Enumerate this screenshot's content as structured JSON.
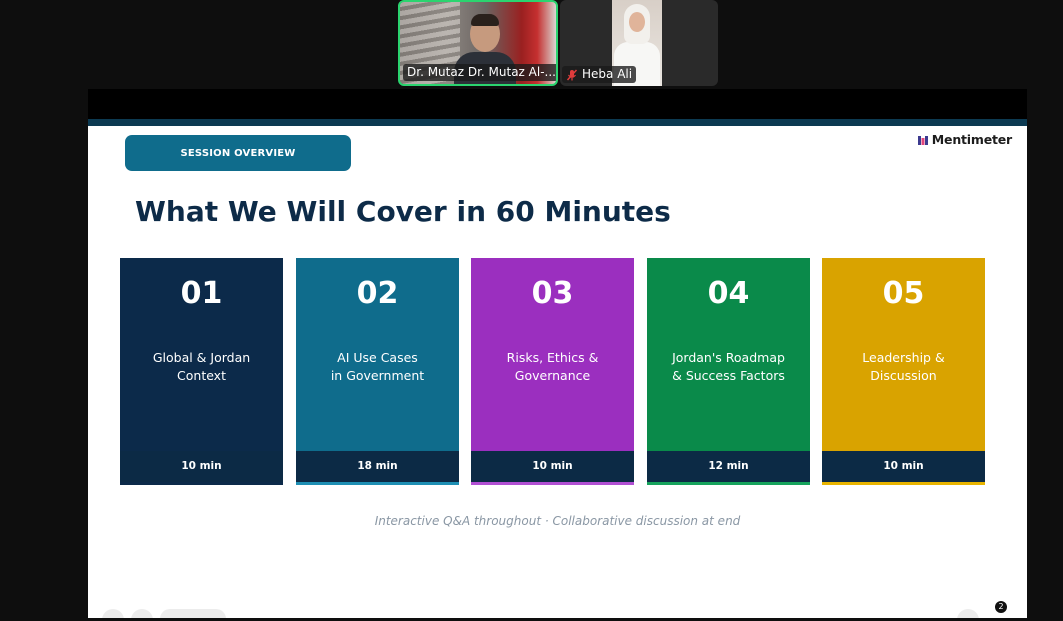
{
  "participants": [
    {
      "name": "Dr. Mutaz Dr. Mutaz Al-...",
      "muted": false,
      "active_speaker": true
    },
    {
      "name": "Heba Ali",
      "muted": true,
      "active_speaker": false
    }
  ],
  "slide": {
    "section_label": "SESSION OVERVIEW",
    "brand": "Mentimeter",
    "title": "What We Will Cover in 60 Minutes",
    "cards": [
      {
        "number": "01",
        "label": "Global & Jordan\nContext",
        "duration": "10 min",
        "color": "#0c2a4a",
        "accent": "#0c2a4a"
      },
      {
        "number": "02",
        "label": "AI Use Cases\nin Government",
        "duration": "18 min",
        "color": "#0f6c8c",
        "accent": "#1e8fb4"
      },
      {
        "number": "03",
        "label": "Risks, Ethics &\nGovernance",
        "duration": "10 min",
        "color": "#9b2fbf",
        "accent": "#b14fd3"
      },
      {
        "number": "04",
        "label": "Jordan's Roadmap\n& Success Factors",
        "duration": "12 min",
        "color": "#0a8a4a",
        "accent": "#16a35c"
      },
      {
        "number": "05",
        "label": "Leadership &\nDiscussion",
        "duration": "10 min",
        "color": "#d9a300",
        "accent": "#e8b400"
      }
    ],
    "footer_note": "Interactive Q&A throughout  ·  Collaborative discussion at end",
    "reaction_count": "2"
  }
}
